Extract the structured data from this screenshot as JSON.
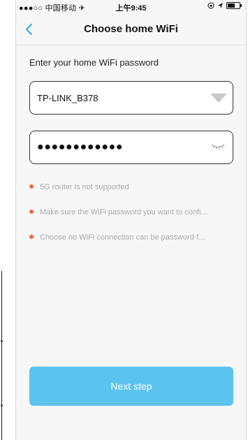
{
  "status_bar": {
    "carrier": "●●●○○ 中国移动 ✈",
    "time": "上午9:45"
  },
  "nav": {
    "back_icon": "back-chevron-icon",
    "title": "Choose home WiFi"
  },
  "form": {
    "instruction": "Enter your home WiFi password",
    "ssid_value": "TP-LINK_B378",
    "password_value": "●●●●●●●●●●●●",
    "dropdown_icon": "dropdown-triangle-icon",
    "password_toggle_icon": "eye-closed-icon"
  },
  "tips": [
    "5G router is not supported",
    "Make sure the WiFi password you want to confi...",
    "Choose no WiFi connection can be password-f..."
  ],
  "next_button_label": "Next step",
  "colors": {
    "accent": "#2fa8e6",
    "button": "#5cc3ee",
    "tip_dot": "#f16a3a"
  }
}
